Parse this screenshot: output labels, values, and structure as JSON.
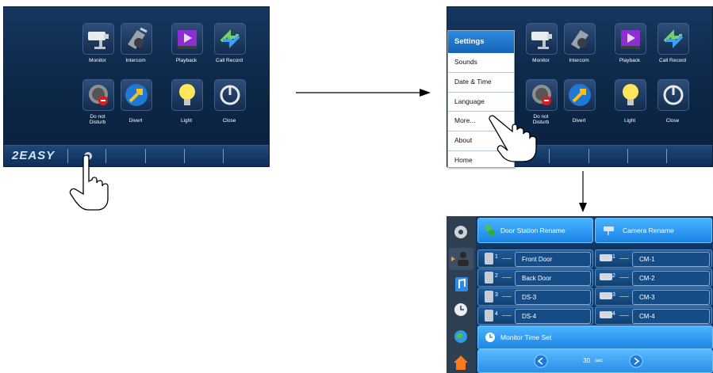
{
  "screen1": {
    "logo": "2EASY",
    "tiles": [
      {
        "label": "Monitor",
        "icon": "cctv-camera-icon"
      },
      {
        "label": "Intercom",
        "icon": "intercom-handset-icon"
      },
      {
        "label": "Playback",
        "icon": "playback-film-icon"
      },
      {
        "label": "Call Record",
        "icon": "call-record-arrows-icon"
      },
      {
        "label": "Do not\nDisturb",
        "icon": "do-not-disturb-icon"
      },
      {
        "label": "Divert",
        "icon": "divert-arrow-icon"
      },
      {
        "label": "Light",
        "icon": "light-bulb-icon"
      },
      {
        "label": "Close",
        "icon": "power-icon"
      }
    ]
  },
  "screen2": {
    "menu": {
      "title": "Settings",
      "items": [
        "Sounds",
        "Date & Time",
        "Language",
        "More...",
        "About",
        "Home"
      ]
    }
  },
  "screen3": {
    "door_header": "Door Station Rename",
    "camera_header": "Camera Rename",
    "doors": [
      {
        "num": "1",
        "name": "Front Door"
      },
      {
        "num": "2",
        "name": "Back Door"
      },
      {
        "num": "3",
        "name": "DS-3"
      },
      {
        "num": "4",
        "name": "DS-4"
      }
    ],
    "cameras": [
      {
        "num": "1",
        "name": "CM-1"
      },
      {
        "num": "2",
        "name": "CM-2"
      },
      {
        "num": "3",
        "name": "CM-3"
      },
      {
        "num": "4",
        "name": "CM-4"
      }
    ],
    "monitor_time_label": "Monitor Time Set",
    "monitor_time_value": "30",
    "monitor_time_unit": "sec"
  },
  "colors": {
    "screen_bg": "#0c2646",
    "accent_blue": "#1a84e6",
    "arrow": "#000000"
  }
}
